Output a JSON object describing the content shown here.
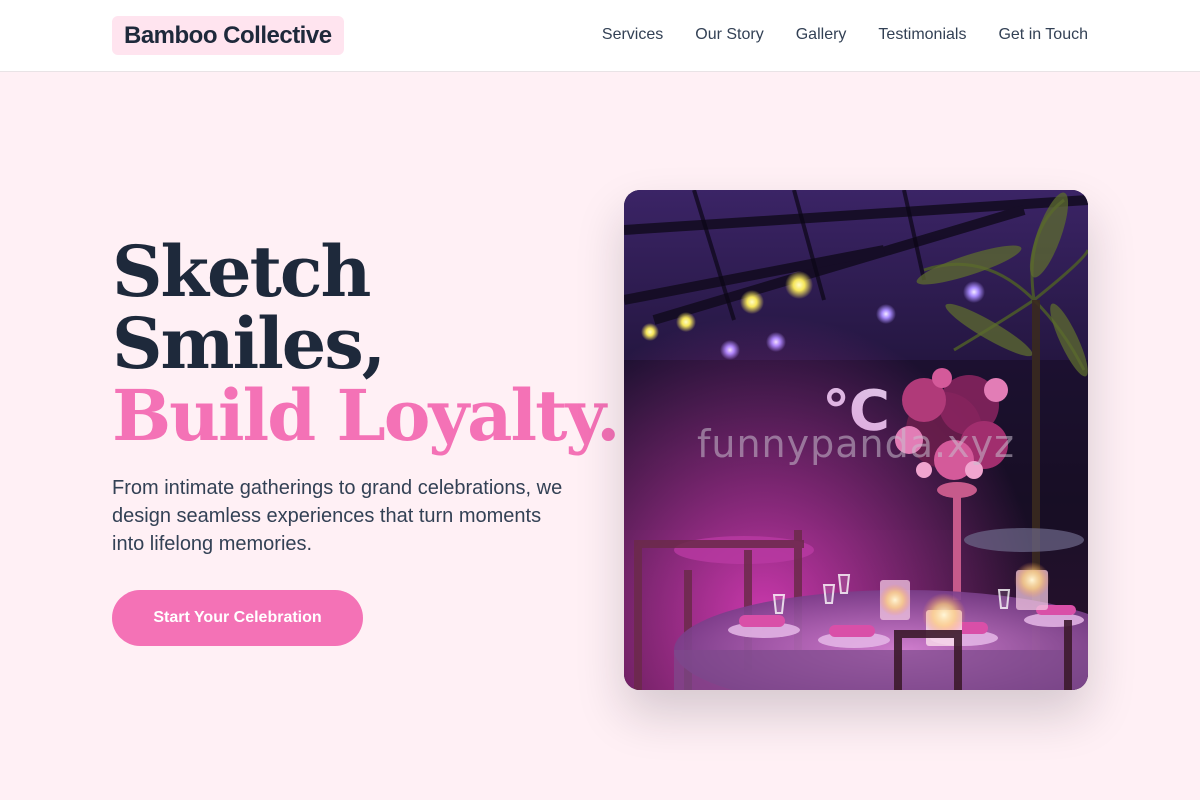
{
  "header": {
    "logo": "Bamboo Collective",
    "nav": [
      "Services",
      "Our Story",
      "Gallery",
      "Testimonials",
      "Get in Touch"
    ]
  },
  "hero": {
    "title_line_1": "Sketch",
    "title_line_2": "Smiles,",
    "title_accent": "Build Loyalty.",
    "subtitle": "From intimate gatherings to grand celebrations, we design seamless experiences that turn moments into lifelong memories.",
    "cta_label": "Start Your Celebration",
    "image_watermark": "funnypanda.xyz"
  },
  "colors": {
    "background": "#fff0f5",
    "accent": "#f472b6",
    "heading": "#1e293b",
    "logo_bg": "#ffe4ef"
  }
}
